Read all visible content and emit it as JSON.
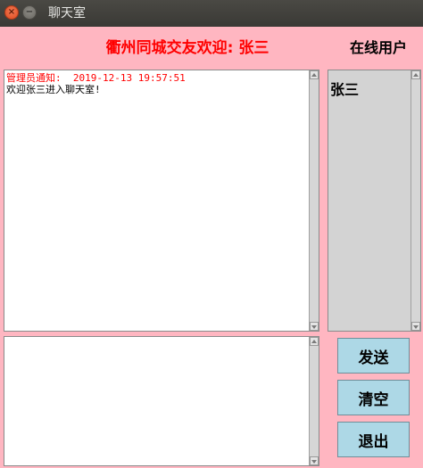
{
  "window": {
    "title": "聊天室",
    "close_symbol": "×",
    "minimize_symbol": "−"
  },
  "header": {
    "welcome": "衢州同城交友欢迎: 张三",
    "online_label": "在线用户"
  },
  "messages": {
    "notice": "管理员通知:  2019-12-13 19:57:51",
    "welcome_text": "欢迎张三进入聊天室!"
  },
  "online_users": [
    "张三"
  ],
  "buttons": {
    "send": "发送",
    "clear": "清空",
    "exit": "退出"
  },
  "colors": {
    "background": "#ffb6c1",
    "header_text": "#ff0000",
    "button_bg": "#add8e6",
    "online_list_bg": "#d3d3d3"
  }
}
